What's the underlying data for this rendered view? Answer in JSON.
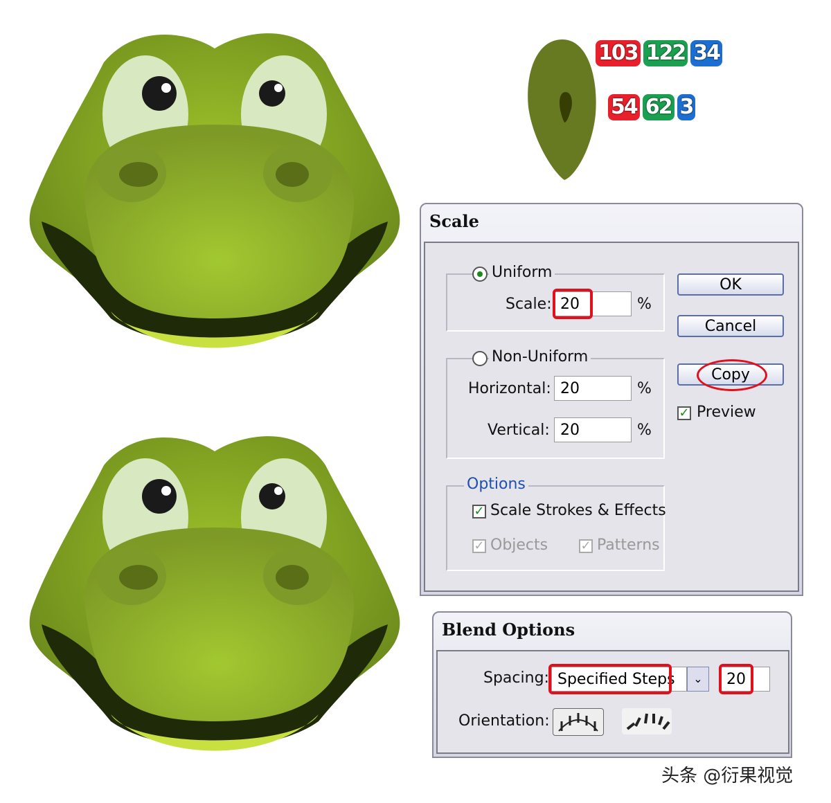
{
  "colors": {
    "light_green": {
      "r": "103",
      "g": "122",
      "b": "34"
    },
    "dark_green": {
      "r": "54",
      "g": "62",
      "b": "3"
    },
    "accent_red": "#e0101c",
    "badge_red": "#e8202c",
    "badge_green": "#1aa050",
    "badge_blue": "#1c6ed0"
  },
  "scale_dialog": {
    "title": "Scale",
    "uniform_label": "Uniform",
    "scale_label": "Scale:",
    "scale_value": "20",
    "percent": "%",
    "non_uniform_label": "Non-Uniform",
    "horizontal_label": "Horizontal:",
    "horizontal_value": "20",
    "vertical_label": "Vertical:",
    "vertical_value": "20",
    "options_label": "Options",
    "scale_strokes_label": "Scale Strokes & Effects",
    "objects_label": "Objects",
    "patterns_label": "Patterns",
    "ok_label": "OK",
    "cancel_label": "Cancel",
    "copy_label": "Copy",
    "preview_label": "Preview"
  },
  "blend_dialog": {
    "title": "Blend Options",
    "spacing_label": "Spacing:",
    "spacing_value": "Specified Steps",
    "steps_value": "20",
    "orientation_label": "Orientation:"
  },
  "watermark": "头条 @衍果视觉"
}
